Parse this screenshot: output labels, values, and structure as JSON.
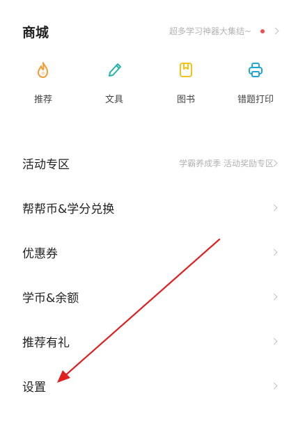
{
  "shop": {
    "title": "商城",
    "subtitle": "超多学习神器大集结~",
    "categories": [
      {
        "label": "推荐",
        "icon": "flame-icon",
        "color": "#f59a2f"
      },
      {
        "label": "文具",
        "icon": "pen-icon",
        "color": "#22b3a8"
      },
      {
        "label": "图书",
        "icon": "book-icon",
        "color": "#f0c419"
      },
      {
        "label": "错题打印",
        "icon": "printer-icon",
        "color": "#1fa5d6"
      }
    ]
  },
  "menu": {
    "items": [
      {
        "label": "活动专区",
        "extra": "学霸养成季 活动奖励专区"
      },
      {
        "label": "帮帮币&学分兑换",
        "extra": ""
      },
      {
        "label": "优惠券",
        "extra": ""
      },
      {
        "label": "学币&余额",
        "extra": ""
      },
      {
        "label": "推荐有礼",
        "extra": ""
      },
      {
        "label": "设置",
        "extra": ""
      }
    ]
  },
  "annotation": {
    "color": "#e02020"
  }
}
